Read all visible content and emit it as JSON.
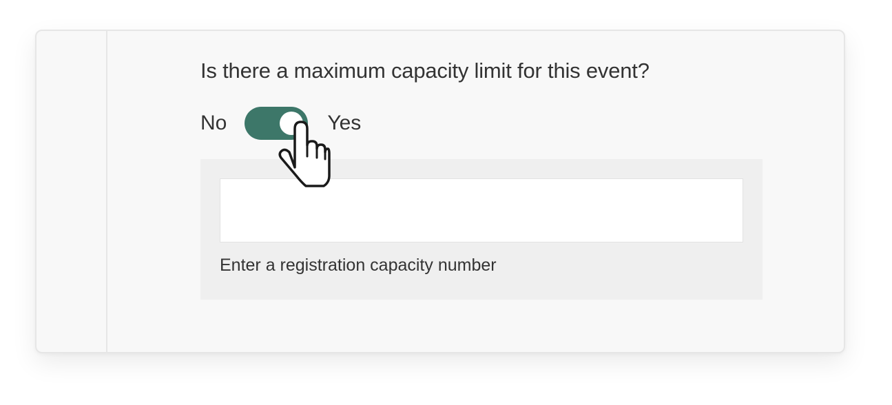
{
  "question": {
    "text": "Is there a maximum capacity limit for this event?"
  },
  "toggle": {
    "off_label": "No",
    "on_label": "Yes",
    "state": "on",
    "on_color": "#3d7769"
  },
  "capacity": {
    "input_value": "",
    "hint": "Enter a registration capacity number"
  },
  "cursor": {
    "icon": "hand-pointer-icon"
  }
}
